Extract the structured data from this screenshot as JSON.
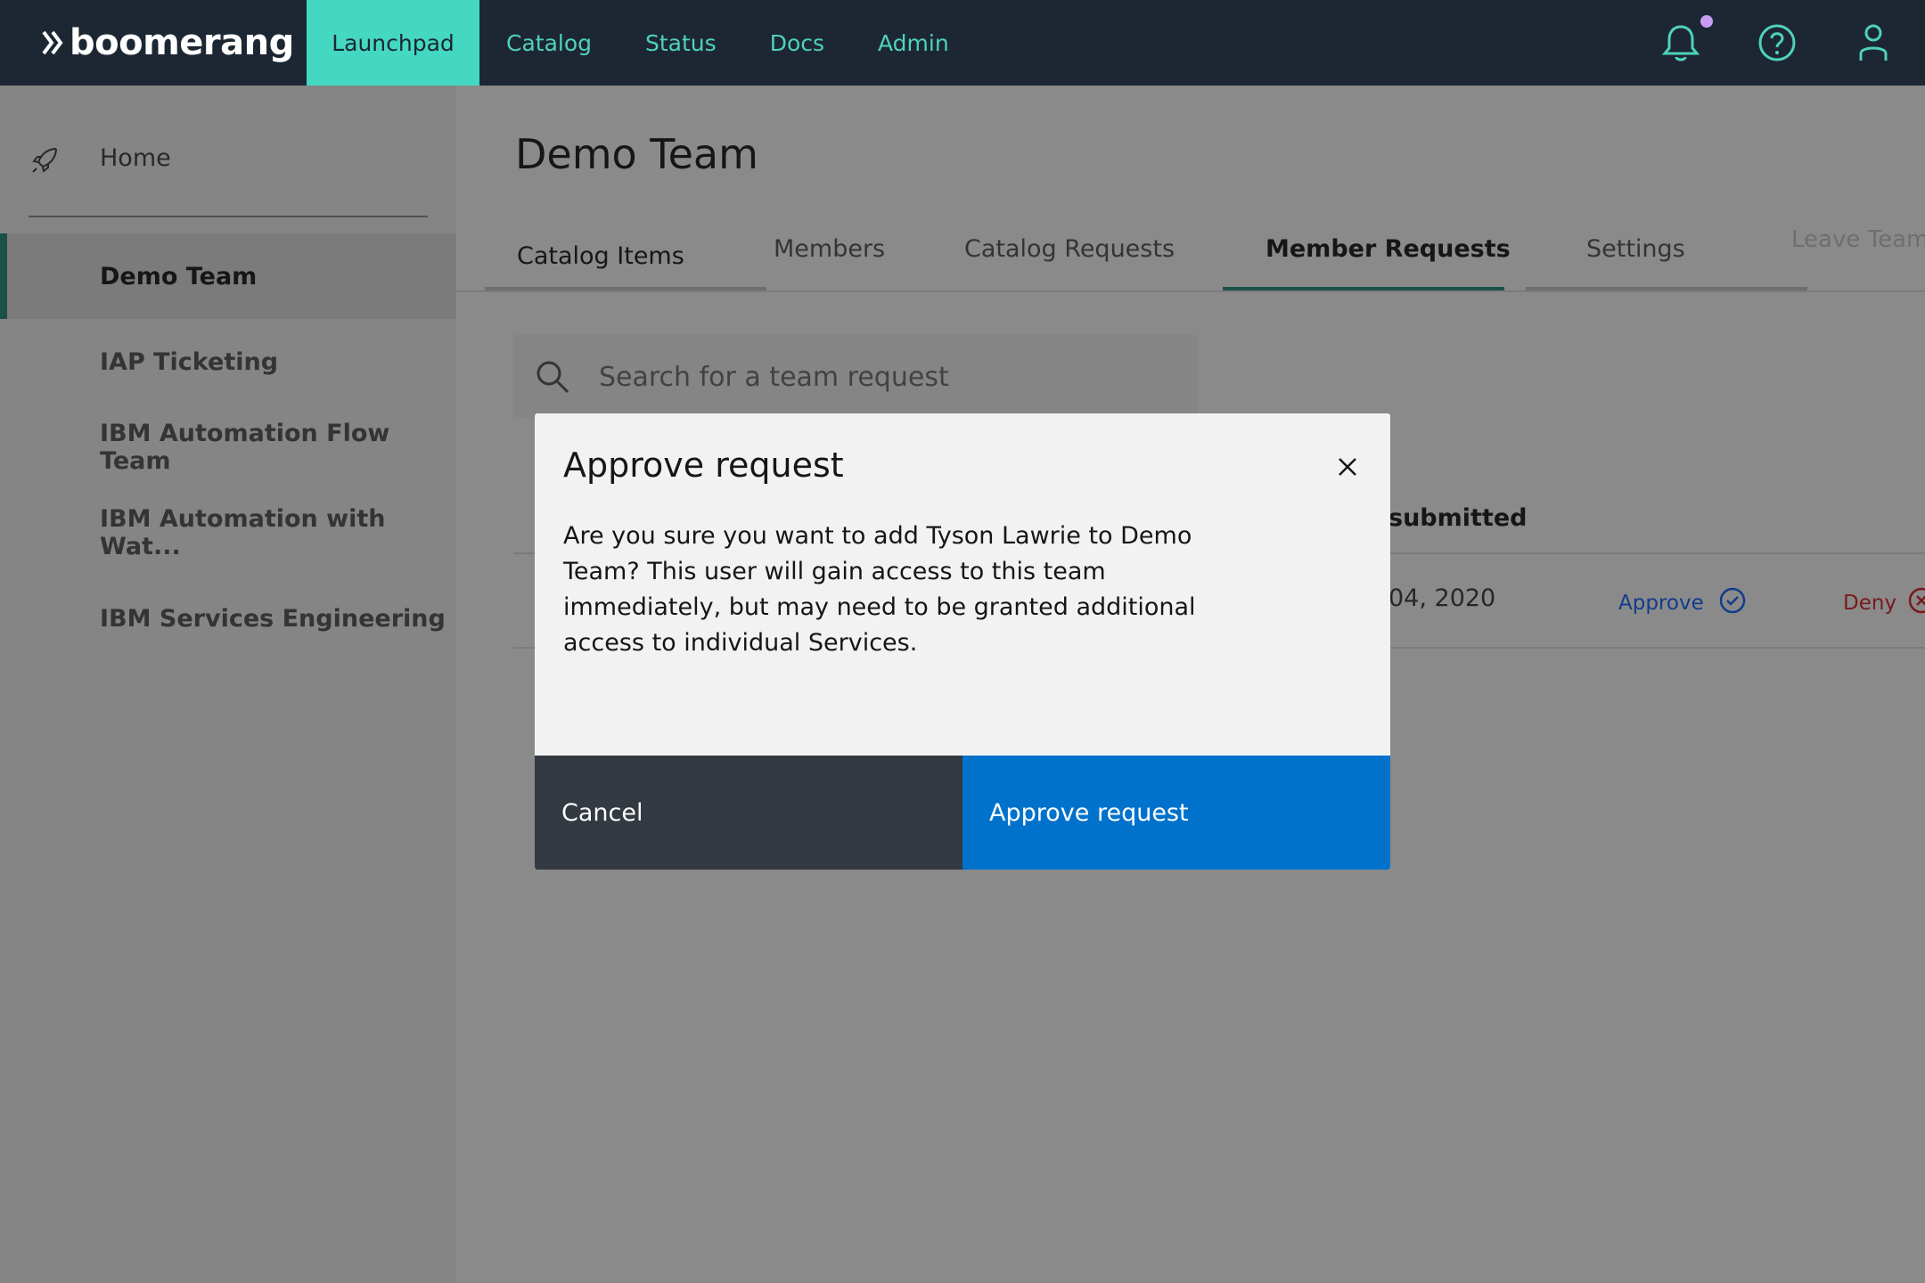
{
  "header": {
    "logo": "boomerang",
    "nav": [
      {
        "label": "Launchpad",
        "active": true
      },
      {
        "label": "Catalog",
        "active": false
      },
      {
        "label": "Status",
        "active": false
      },
      {
        "label": "Docs",
        "active": false
      },
      {
        "label": "Admin",
        "active": false
      }
    ],
    "icons": [
      "bell-icon",
      "help-icon",
      "user-icon"
    ],
    "colors": {
      "bg": "#1c2733",
      "accent": "#44d7c1",
      "notification_dot": "#c79cf3"
    }
  },
  "sidebar": {
    "home_label": "Home",
    "home_icon": "rocket-icon",
    "teams": [
      {
        "label": "Demo Team",
        "active": true
      },
      {
        "label": "IAP Ticketing",
        "active": false
      },
      {
        "label": "IBM Automation Flow Team",
        "active": false
      },
      {
        "label": "IBM Automation with Wat...",
        "active": false
      },
      {
        "label": "IBM Services Engineering",
        "active": false
      }
    ]
  },
  "main": {
    "title": "Demo Team",
    "tabs": [
      {
        "label": "Catalog Items"
      },
      {
        "label": "Members"
      },
      {
        "label": "Catalog Requests"
      },
      {
        "label": "Member Requests",
        "active": true
      },
      {
        "label": "Settings"
      }
    ],
    "leave_team": "Leave Team",
    "search": {
      "placeholder": "Search for a team request"
    },
    "table": {
      "visible_header": "submitted",
      "row": {
        "date_fragment": "04, 2020",
        "approve": "Approve",
        "deny": "Deny"
      }
    }
  },
  "modal": {
    "title": "Approve request",
    "body": "Are you sure you want to add Tyson Lawrie to Demo Team? This user will gain access to this team immediately, but may need to be granted additional access to individual Services.",
    "cancel": "Cancel",
    "confirm": "Approve request",
    "colors": {
      "confirm": "#0072cc",
      "cancel": "#333a41"
    }
  }
}
